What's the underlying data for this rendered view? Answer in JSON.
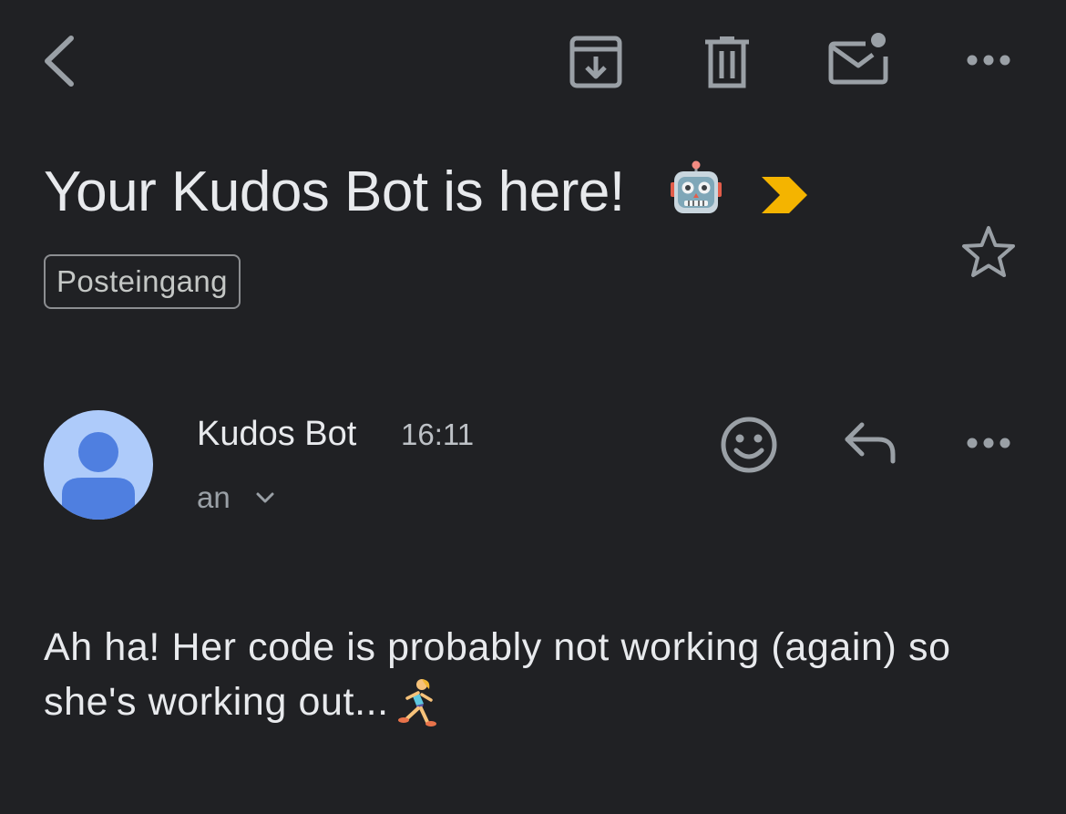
{
  "toolbar": {
    "back_icon": "back-arrow-icon",
    "archive_icon": "archive-icon",
    "delete_icon": "trash-icon",
    "mark_unread_icon": "mark-unread-icon",
    "more_icon": "more-horizontal-icon"
  },
  "email": {
    "subject": "Your Kudos Bot is here!",
    "subject_emoji": "robot-face-icon",
    "importance_marker": "importance-marker-icon",
    "label": "Posteingang",
    "starred": false
  },
  "message": {
    "sender_name": "Kudos Bot",
    "time": "16:11",
    "recipient_prefix": "an",
    "body": "Ah ha! Her code is probably not working (again) so she's working out...",
    "body_emoji": "woman-running-icon"
  },
  "colors": {
    "background": "#202124",
    "text_primary": "#e8eaed",
    "icon_gray": "#9aa0a6",
    "importance_yellow": "#f4b400",
    "avatar_bg": "#aecbfa",
    "avatar_fg": "#4f7fe0"
  }
}
